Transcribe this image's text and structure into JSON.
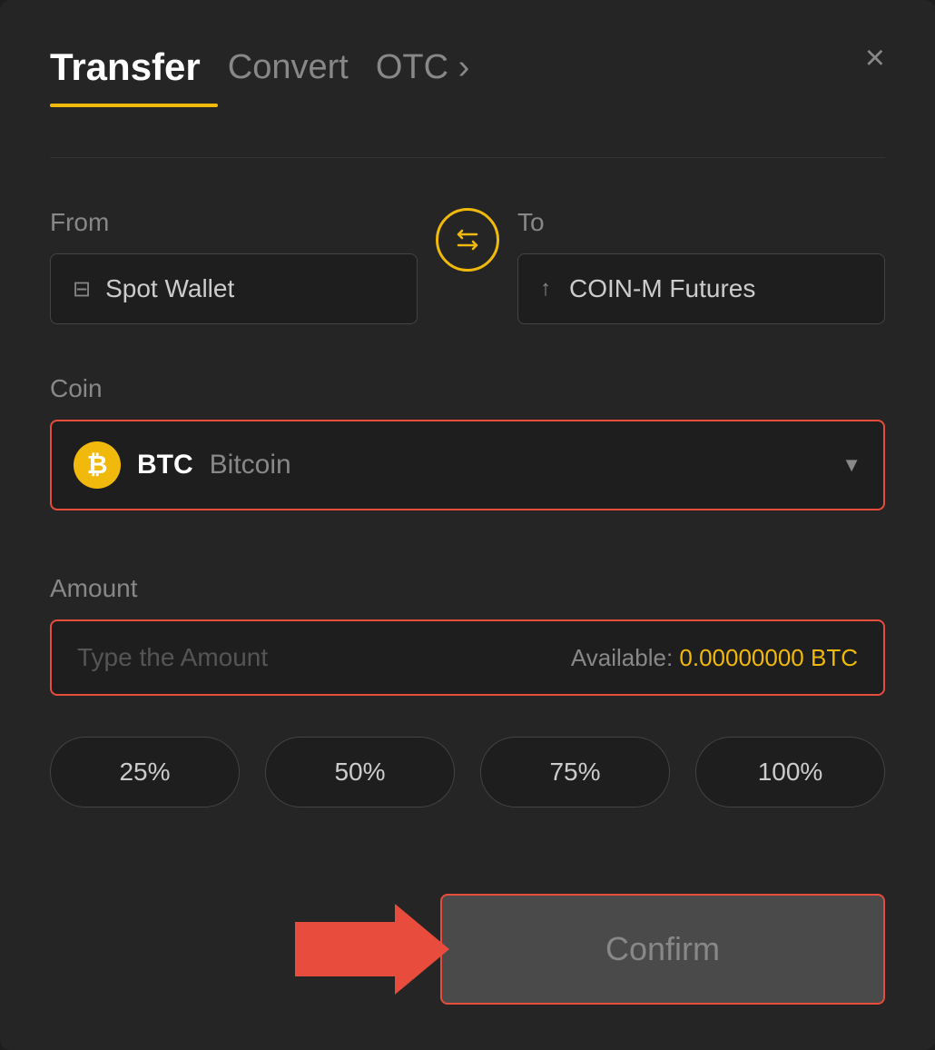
{
  "modal": {
    "title": "Transfer",
    "tabs": [
      {
        "label": "Transfer",
        "active": true
      },
      {
        "label": "Convert",
        "active": false
      },
      {
        "label": "OTC ›",
        "active": false
      }
    ],
    "close_label": "×"
  },
  "from": {
    "label": "From",
    "wallet_name": "Spot Wallet"
  },
  "to": {
    "label": "To",
    "wallet_name": "COIN-M Futures"
  },
  "coin": {
    "label": "Coin",
    "symbol": "BTC",
    "name": "Bitcoin"
  },
  "amount": {
    "label": "Amount",
    "placeholder": "Type the Amount",
    "available_label": "Available:",
    "available_value": "0.00000000 BTC"
  },
  "percentages": [
    "25%",
    "50%",
    "75%",
    "100%"
  ],
  "confirm": {
    "label": "Confirm"
  }
}
